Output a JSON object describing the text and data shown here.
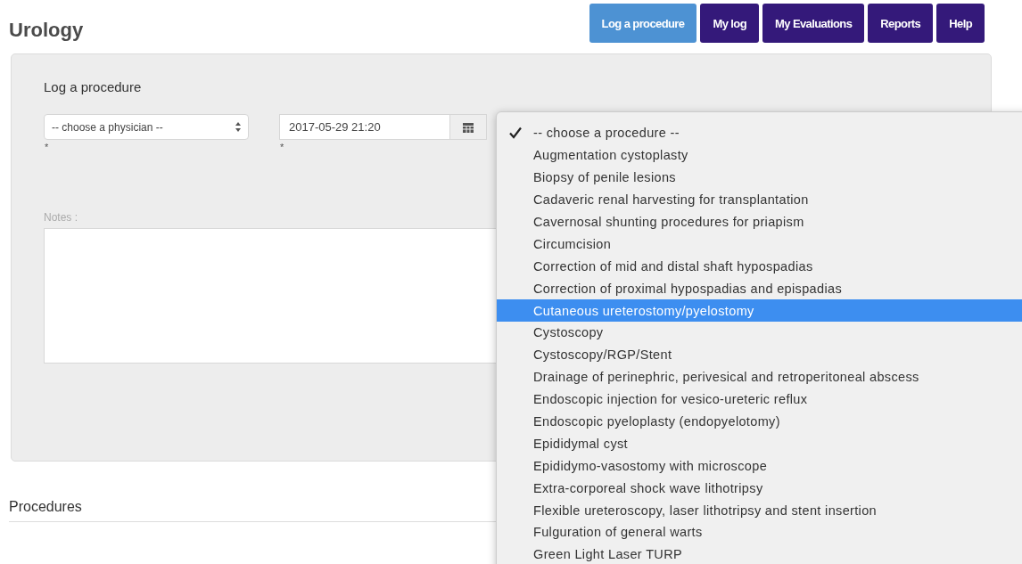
{
  "page_title": "Urology",
  "nav": [
    {
      "label": "Log a procedure",
      "selected": true
    },
    {
      "label": "My log",
      "selected": false
    },
    {
      "label": "My Evaluations",
      "selected": false
    },
    {
      "label": "Reports",
      "selected": false
    },
    {
      "label": "Help",
      "selected": false
    }
  ],
  "form": {
    "title": "Log a procedure",
    "physician_select": {
      "value": "-- choose a physician --",
      "required_mark": "*"
    },
    "date_field": {
      "value": "2017-05-29 21:20",
      "required_mark": "*"
    },
    "notes": {
      "label": "Notes :"
    }
  },
  "procedures_heading": "Procedures",
  "procedure_dropdown": {
    "options": [
      {
        "label": "-- choose a procedure --",
        "checked": true,
        "selected": false
      },
      {
        "label": "Augmentation cystoplasty",
        "checked": false,
        "selected": false
      },
      {
        "label": "Biopsy of penile lesions",
        "checked": false,
        "selected": false
      },
      {
        "label": "Cadaveric renal harvesting for transplantation",
        "checked": false,
        "selected": false
      },
      {
        "label": "Cavernosal shunting procedures for priapism",
        "checked": false,
        "selected": false
      },
      {
        "label": "Circumcision",
        "checked": false,
        "selected": false
      },
      {
        "label": "Correction of mid and distal shaft hypospadias",
        "checked": false,
        "selected": false
      },
      {
        "label": "Correction of proximal hypospadias and epispadias",
        "checked": false,
        "selected": false
      },
      {
        "label": "Cutaneous ureterostomy/pyelostomy",
        "checked": false,
        "selected": true
      },
      {
        "label": "Cystoscopy",
        "checked": false,
        "selected": false
      },
      {
        "label": "Cystoscopy/RGP/Stent",
        "checked": false,
        "selected": false
      },
      {
        "label": "Drainage of perinephric, perivesical and retroperitoneal abscess",
        "checked": false,
        "selected": false
      },
      {
        "label": "Endoscopic injection for vesico-ureteric reflux",
        "checked": false,
        "selected": false
      },
      {
        "label": "Endoscopic pyeloplasty (endopyelotomy)",
        "checked": false,
        "selected": false
      },
      {
        "label": "Epididymal cyst",
        "checked": false,
        "selected": false
      },
      {
        "label": "Epididymo-vasostomy with microscope",
        "checked": false,
        "selected": false
      },
      {
        "label": "Extra-corporeal shock wave lithotripsy",
        "checked": false,
        "selected": false
      },
      {
        "label": "Flexible ureteroscopy, laser lithotripsy and stent insertion",
        "checked": false,
        "selected": false
      },
      {
        "label": "Fulguration of general warts",
        "checked": false,
        "selected": false
      },
      {
        "label": "Green Light Laser TURP",
        "checked": false,
        "selected": false
      }
    ]
  }
}
